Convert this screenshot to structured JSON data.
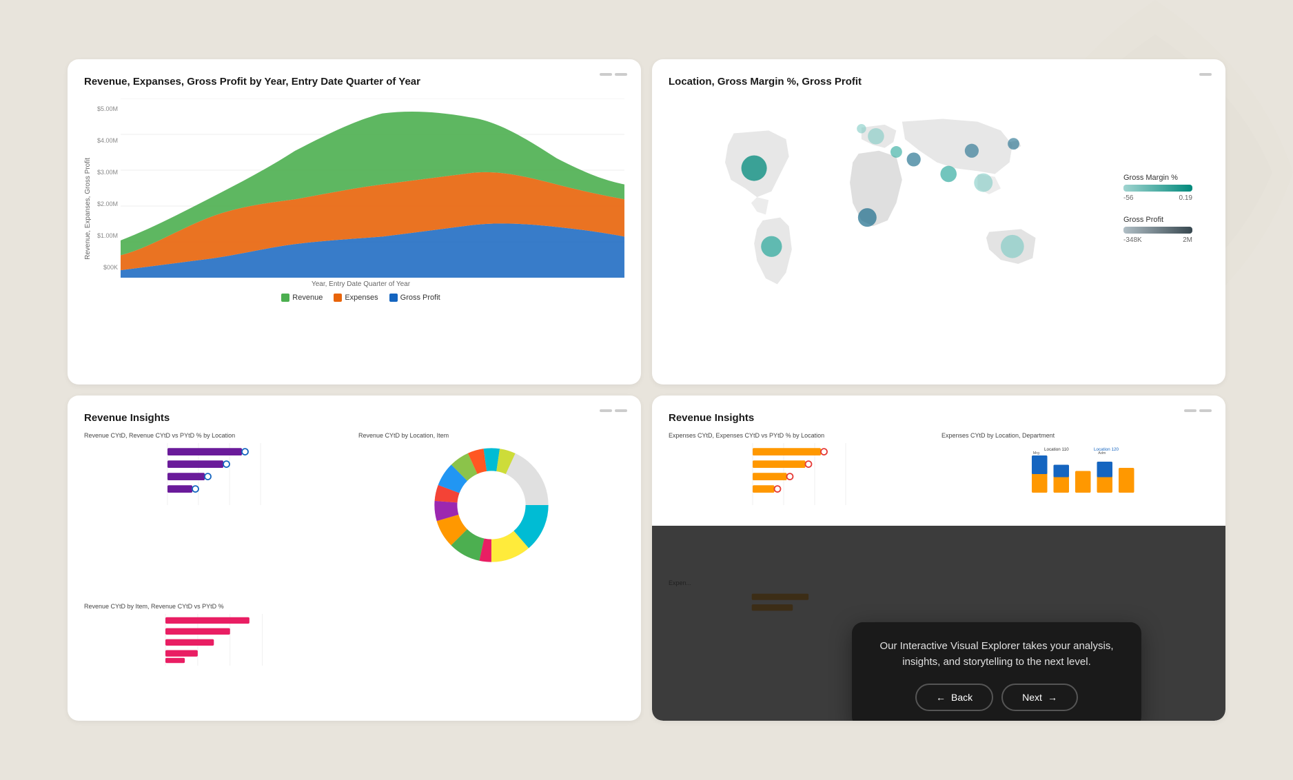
{
  "cards": {
    "top_left": {
      "title": "Revenue, Expanses, Gross Profit by Year, Entry Date Quarter of Year",
      "xlabel": "Year, Entry Date Quarter of Year",
      "ylabel": "Revenue, Expanses, Gross Profit",
      "yaxis": [
        "$5.00M",
        "$4.00M",
        "$3.00M",
        "$2.00M",
        "$1.00M",
        "$00K"
      ],
      "legend": [
        {
          "label": "Revenue",
          "color": "#4caf50"
        },
        {
          "label": "Expenses",
          "color": "#e8640a"
        },
        {
          "label": "Gross Profit",
          "color": "#1565c0"
        }
      ]
    },
    "top_right": {
      "title": "Location, Gross Margin %, Gross Profit",
      "legend1_title": "Gross Margin %",
      "legend1_range_min": "-56",
      "legend1_range_max": "0.19",
      "legend1_color_start": "#a0d4d0",
      "legend1_color_end": "#00897b",
      "legend2_title": "Gross Profit",
      "legend2_range_min": "-348K",
      "legend2_range_max": "2M"
    },
    "bottom_left": {
      "title": "Revenue Insights",
      "sub1_title": "Revenue CYtD, Revenue CYtD vs PYtD % by Location",
      "sub2_title": "Revenue CYtD by Location, Item",
      "sub3_title": "Revenue CYtD by Item, Revenue CYtD vs PYtD %"
    },
    "bottom_right": {
      "title": "Revenue Insights",
      "sub1_title": "Expenses CYtD, Expenses CYtD vs PYtD % by Location",
      "sub2_title": "Expenses CYtD by Location, Department",
      "sub3_title": "Expen..."
    }
  },
  "tooltip": {
    "text": "Our Interactive Visual Explorer takes your analysis, insights, and storytelling to the next level.",
    "back_label": "Back",
    "next_label": "Next",
    "back_arrow": "←",
    "next_arrow": "→"
  }
}
